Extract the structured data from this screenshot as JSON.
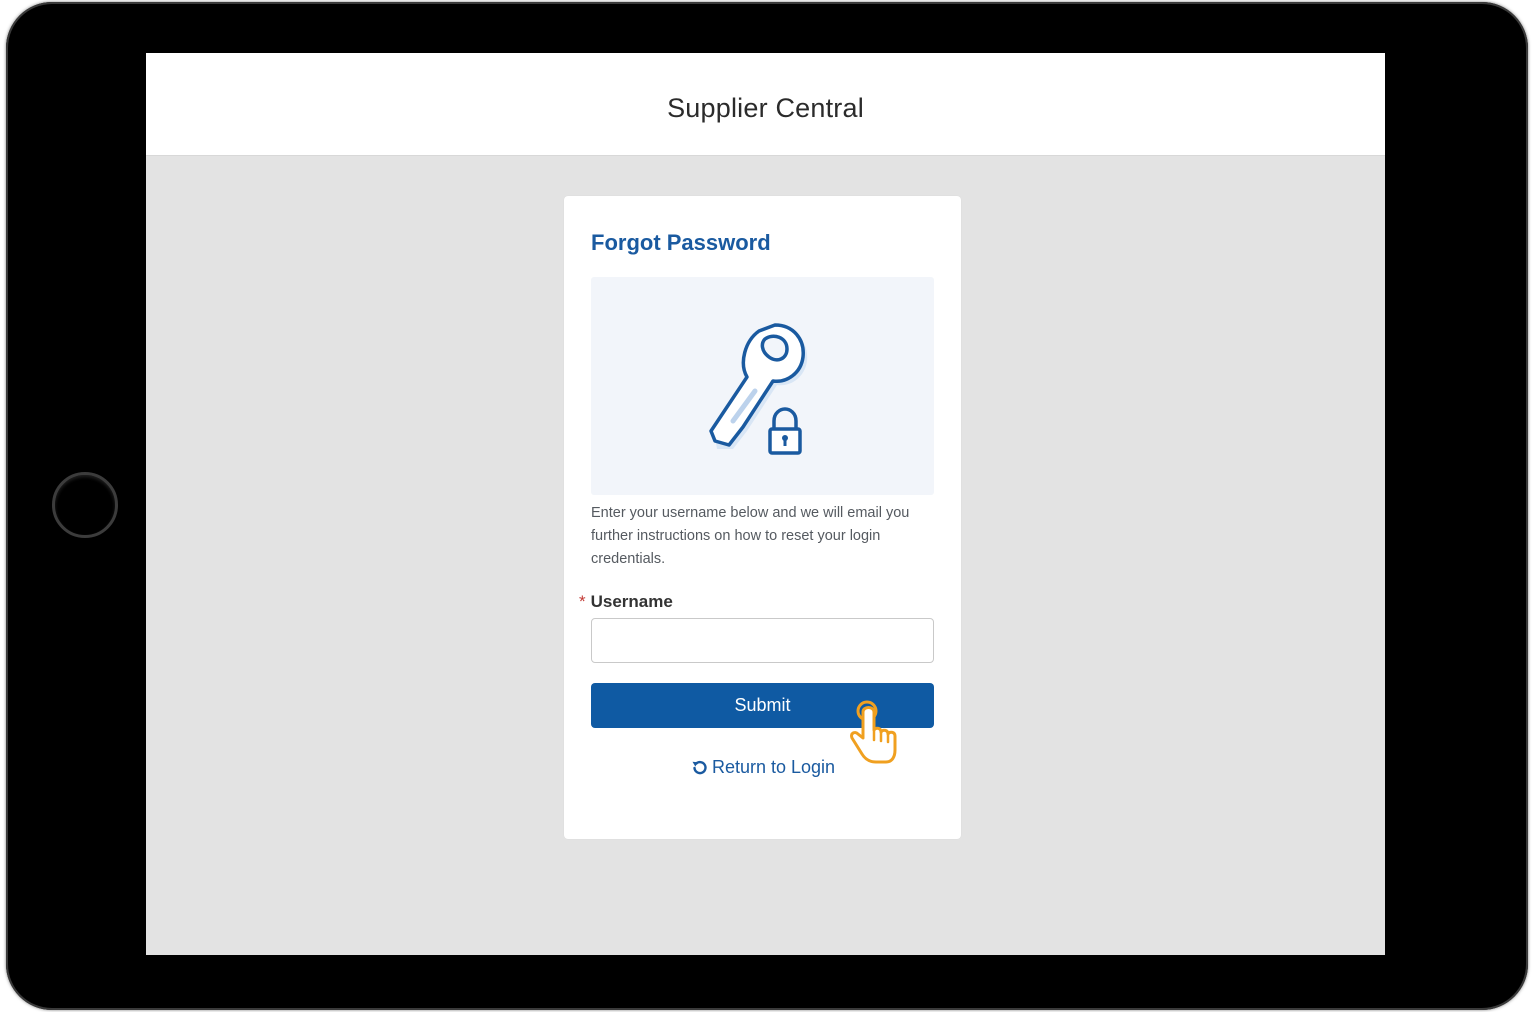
{
  "header": {
    "title": "Supplier Central"
  },
  "card": {
    "title": "Forgot Password",
    "description": "Enter your username below and we will email you further instructions on how to reset your login credentials.",
    "username_label": "Username",
    "required_marker": "*",
    "username_value": "",
    "submit_label": "Submit",
    "return_label": "Return to Login"
  },
  "icons": {
    "illustration": "key-lock-icon",
    "return": "undo-icon",
    "cursor": "hand-pointer-icon"
  },
  "colors": {
    "accent": "#1a5aa0",
    "button": "#0f5aa3",
    "required": "#c23934",
    "cursor": "#f0a020"
  }
}
